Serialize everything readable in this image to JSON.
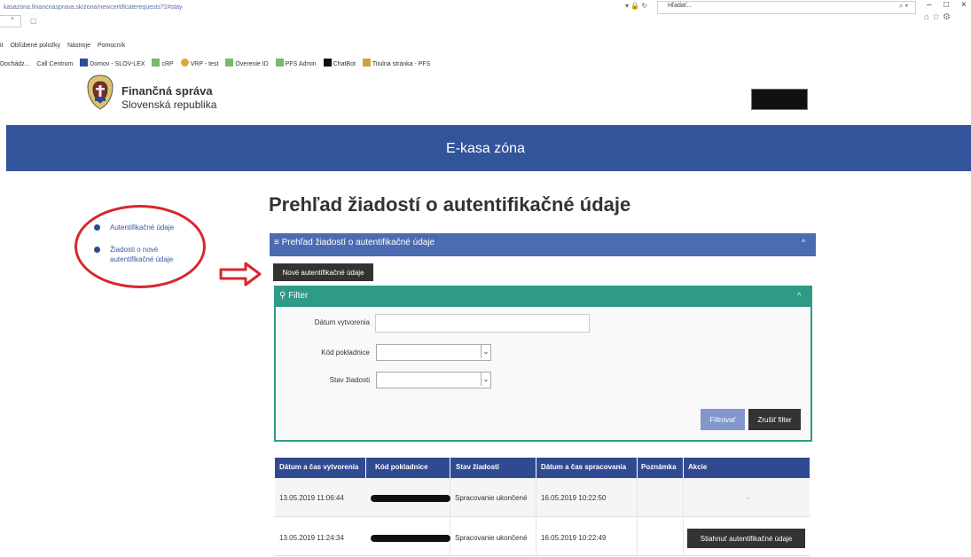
{
  "browser": {
    "url": "kasazona.financnasprava.sk/zona/newcertificaterequests?2#stay",
    "search_placeholder": "Hľadať...",
    "menu": [
      "Obľúbené položky",
      "Nástroje",
      "Pomocník"
    ],
    "menu_prefix": "it",
    "favorites": [
      "Dochádz...",
      "Call Centrum",
      "Domov - SLOV-LEX",
      "cRP",
      "VRP - test",
      "Overenie ID",
      "PFS Admin",
      "ChatBot",
      "Titulná stránka - PFS"
    ]
  },
  "site": {
    "brand_line1": "Finančná správa",
    "brand_line2": "Slovenská republika",
    "banner_title": "E-kasa zóna"
  },
  "sidebar": {
    "items": [
      {
        "label": "Autentifikačné údaje"
      },
      {
        "label_line1": "Žiadosti o nové",
        "label_line2": "autentifikačné údaje"
      }
    ]
  },
  "main": {
    "page_title": "Prehľad žiadostí o autentifikačné údaje",
    "panel_title": "Prehľad žiadostí o autentifikačné údaje",
    "new_button": "Nové autentifikačné údaje",
    "filter": {
      "title": "Filter",
      "date_label": "Dátum vytvorenia",
      "date_value": "",
      "cash_label": "Kód pokladnice",
      "cash_value": "",
      "state_label": "Stav žiadosti",
      "state_value": "",
      "filter_button": "Filtrovať",
      "clear_button": "Zrušiť filter"
    },
    "table": {
      "headers": [
        "Dátum a čas vytvorenia",
        "Kód pokladnice",
        "Stav žiadosti",
        "Dátum a čas spracovania",
        "Poznámka",
        "Akcie"
      ],
      "rows": [
        {
          "created": "13.05.2019 11:06:44",
          "state": "Spracovanie ukončené",
          "processed": "16.05.2019 10:22:50",
          "note": "",
          "action": "-"
        },
        {
          "created": "13.05.2019 11:24:34",
          "state": "Spracovanie ukončené",
          "processed": "16.05.2019 10:22:49",
          "note": "",
          "action": "Stiahnuť autentifikačné údaje"
        }
      ]
    }
  },
  "colors": {
    "banner": "#33549b",
    "panel": "#4b6cb0",
    "filter": "#2e9b86",
    "table_head": "#304a92",
    "highlight": "#d8262d"
  }
}
